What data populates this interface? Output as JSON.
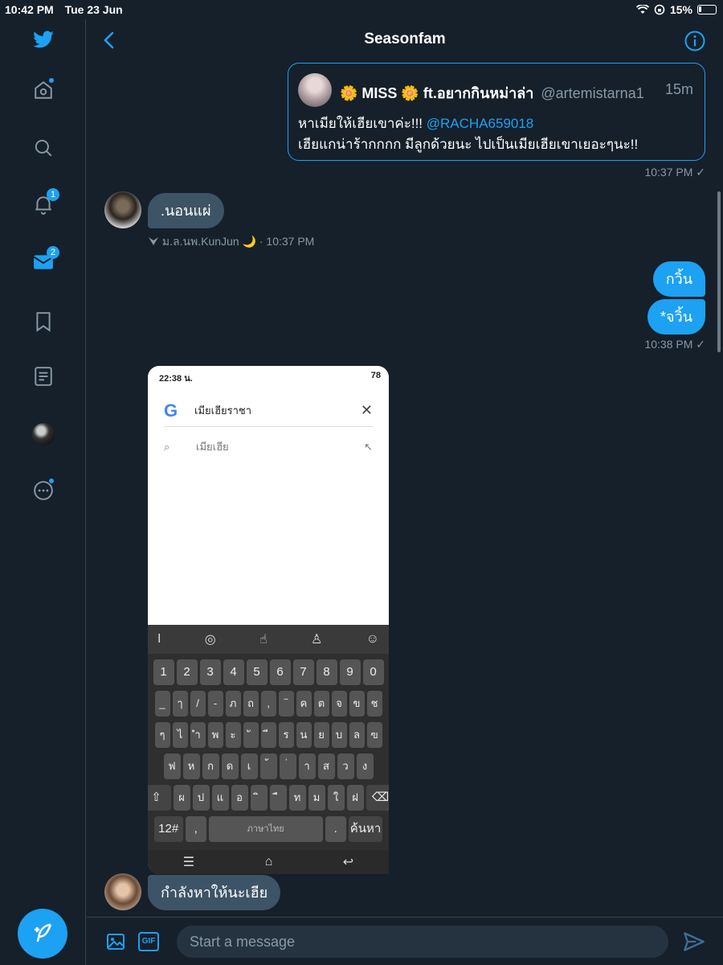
{
  "status_bar": {
    "time": "10:42 PM",
    "date": "Tue 23 Jun",
    "battery": "15%"
  },
  "sidebar": {
    "notifications_badge": "1",
    "messages_badge": "2"
  },
  "header": {
    "title": "Seasonfam"
  },
  "messages": {
    "quote": {
      "name": "🌼 MISS 🌼 ft.อยากกินหม่าล่า",
      "handle": "@artemistarna1",
      "time": "15m",
      "line1_text": "หาเมียให้เฮียเขาค่ะ!!! ",
      "line1_mention": "@RACHA659018",
      "line2": "เฮียแกน่าร้ากกกก มีลูกด้วยนะ ไปเป็นเมียเฮียเขาเยอะๆนะ!!"
    },
    "quote_timestamp": "10:37 PM ✓",
    "incoming_1": ".นอนแผ่",
    "incoming_1_sender": "ม.ล.นพ.KunJun 🌙 · 10:37 PM",
    "outgoing_1": "กวิ้น",
    "outgoing_2": "*จวิ้น",
    "outgoing_timestamp": "10:38 PM ✓",
    "incoming_2": "กำลังหาให้นะเฮีย"
  },
  "media": {
    "status_time": "22:38 น.",
    "battery": "78",
    "search_query": "เมียเฮียราชา",
    "suggestion": "เมียเฮีย",
    "keyboard": {
      "row1": [
        "1",
        "2",
        "3",
        "4",
        "5",
        "6",
        "7",
        "8",
        "9",
        "0"
      ],
      "row2": [
        "_",
        "ๅ",
        "/",
        "-",
        "ภ",
        "ถ",
        ",",
        "‾",
        "ค",
        "ต",
        "จ",
        "ข",
        "ช"
      ],
      "row3": [
        "ๆ",
        "ไ",
        "ำ",
        "พ",
        "ะ",
        "ั",
        "ี",
        "ร",
        "น",
        "ย",
        "บ",
        "ล",
        "ฃ"
      ],
      "row4": [
        "ฟ",
        "ห",
        "ก",
        "ด",
        "เ",
        "้",
        "่",
        "า",
        "ส",
        "ว",
        "ง"
      ],
      "row5": [
        "ผ",
        "ป",
        "แ",
        "อ",
        "ิ",
        "ื",
        "ท",
        "ม",
        "ใ",
        "ฝ"
      ],
      "key_numbers": "12#",
      "key_space": "ภาษาไทย",
      "key_search": "ค้นหา",
      "key_period": "."
    }
  },
  "composer": {
    "placeholder": "Start a message"
  },
  "colors": {
    "accent": "#1da1f2",
    "background": "#15202b",
    "bubble_incoming": "#3d5466"
  }
}
